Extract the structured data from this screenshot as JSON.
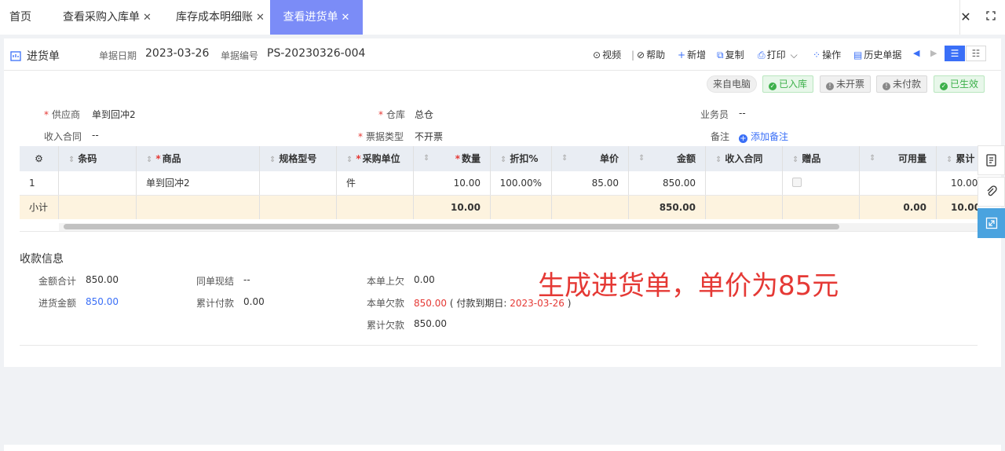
{
  "tabs": [
    {
      "label": "首页",
      "closable": false
    },
    {
      "label": "查看采购入库单",
      "closable": true
    },
    {
      "label": "库存成本明细账",
      "closable": true
    },
    {
      "label": "查看进货单",
      "closable": true,
      "active": true
    }
  ],
  "tabbar": {
    "close_symbol": "✕",
    "fullscreen_symbol": "⛶"
  },
  "doc": {
    "tab_label": "进货单",
    "date_label": "单据日期",
    "date_value": "2023-03-26",
    "no_label": "单据编号",
    "no_value": "PS-20230326-004"
  },
  "toolbar": {
    "video": "视频",
    "help": "帮助",
    "add": "新增",
    "copy": "复制",
    "print": "打印",
    "operate": "操作",
    "history": "历史单据"
  },
  "badges": {
    "source": "来自电脑",
    "stored": "已入库",
    "invoice": "未开票",
    "payment": "未付款",
    "effective": "已生效"
  },
  "form": {
    "supplier_label": "供应商",
    "supplier_value": "单到回冲2",
    "warehouse_label": "仓库",
    "warehouse_value": "总仓",
    "salesman_label": "业务员",
    "salesman_value": "--",
    "contract_label": "收入合同",
    "contract_value": "--",
    "invoice_type_label": "票据类型",
    "invoice_type_value": "不开票",
    "remark_label": "备注",
    "remark_add": "添加备注"
  },
  "table": {
    "headers": {
      "barcode": "条码",
      "product": "商品",
      "spec": "规格型号",
      "unit": "采购单位",
      "qty": "数量",
      "discount": "折扣%",
      "price": "单价",
      "amount": "金额",
      "contract": "收入合同",
      "gift": "赠品",
      "available": "可用量",
      "cumulative": "累计"
    },
    "row": {
      "index": "1",
      "barcode": "",
      "product": "单到回冲2",
      "spec": "",
      "unit": "件",
      "qty": "10.00",
      "discount": "100.00%",
      "price": "85.00",
      "amount": "850.00",
      "contract": "",
      "available": "",
      "cumulative": "10.00"
    },
    "subtotal": {
      "label": "小计",
      "qty": "10.00",
      "amount": "850.00",
      "available": "0.00",
      "cumulative": "10.00"
    }
  },
  "payment": {
    "title": "收款信息",
    "total_label": "金额合计",
    "total_value": "850.00",
    "purchase_label": "进货金额",
    "purchase_value": "850.00",
    "cash_label": "同单现结",
    "cash_value": "--",
    "paid_label": "累计付款",
    "paid_value": "0.00",
    "prev_debt_label": "本单上欠",
    "prev_debt_value": "0.00",
    "debt_label": "本单欠款",
    "debt_value": "850.00",
    "due_prefix": "( 付款到期日:",
    "due_date": "2023-03-26",
    "due_suffix": ")",
    "cum_debt_label": "累计欠款",
    "cum_debt_value": "850.00"
  },
  "annotation": "生成进货单，单价为85元",
  "colors": {
    "accent": "#3a6ff7",
    "active_tab": "#7b8cf7",
    "required": "#e53935",
    "success": "#3cb04a",
    "subtotal_bg": "#fdf3df"
  }
}
